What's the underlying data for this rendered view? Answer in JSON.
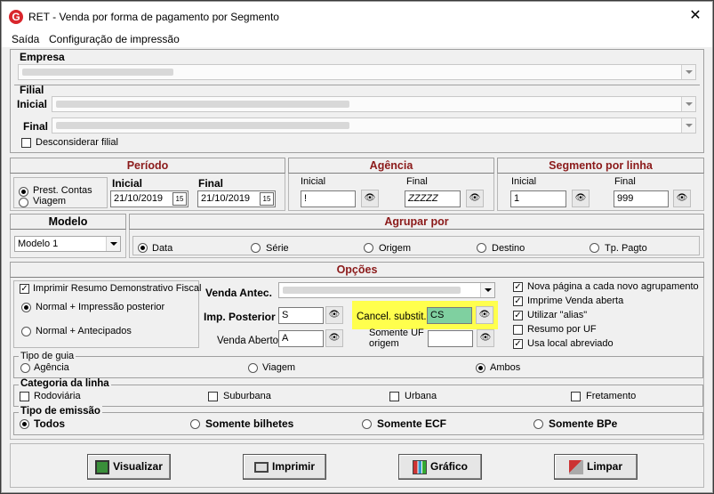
{
  "window": {
    "title": "RET - Venda por forma de pagamento por Segmento",
    "close": "✕",
    "app_icon": "G"
  },
  "menu": [
    "Saída",
    "Configuração de impressão"
  ],
  "empresa": {
    "label": "Empresa"
  },
  "filial": {
    "label": "Filial",
    "inicial": "Inicial",
    "final": "Final",
    "desconsiderar": "Desconsiderar filial"
  },
  "periodo": {
    "title": "Período",
    "prest": "Prest. Contas",
    "viagem": "Viagem",
    "inicial_label": "Inicial",
    "final_label": "Final",
    "inicial": "21/10/2019",
    "final": "21/10/2019",
    "cal": "15"
  },
  "agencia": {
    "title": "Agência",
    "inicial_label": "Inicial",
    "final_label": "Final",
    "inicial": "!",
    "final": "ZZZZZ"
  },
  "segmento": {
    "title": "Segmento por linha",
    "inicial_label": "Inicial",
    "final_label": "Final",
    "inicial": "1",
    "final": "999"
  },
  "modelo": {
    "title": "Modelo",
    "value": "Modelo 1"
  },
  "agrupar": {
    "title": "Agrupar por",
    "options": [
      "Data",
      "Série",
      "Origem",
      "Destino",
      "Tp. Pagto"
    ]
  },
  "opcoes": {
    "title": "Opções",
    "imprimir_resumo": "Imprimir Resumo Demonstrativo Fiscal",
    "normal_impressao": "Normal + Impressão posterior",
    "normal_antecipados": "Normal + Antecipados",
    "venda_antec": "Venda Antec.",
    "imp_posterior": "Imp. Posterior",
    "imp_posterior_value": "S",
    "venda_aberto": "Venda Aberto",
    "venda_aberto_value": "A",
    "cancel_subst": "Cancel. substit.",
    "cancel_subst_value": "CS",
    "somente_uf": "Somente UF",
    "origem": "origem",
    "checks": [
      "Nova página a cada novo agrupamento",
      "Imprime Venda aberta",
      "Utilizar \"alias\"",
      "Resumo por UF",
      "Usa local abreviado"
    ]
  },
  "tipo_guia": {
    "title": "Tipo de guia",
    "options": [
      "Agência",
      "Viagem",
      "Ambos"
    ]
  },
  "categoria": {
    "title": "Categoria da linha",
    "options": [
      "Rodoviária",
      "Suburbana",
      "Urbana",
      "Fretamento"
    ]
  },
  "emissao": {
    "title": "Tipo de emissão",
    "options": [
      "Todos",
      "Somente bilhetes",
      "Somente ECF",
      "Somente BPe"
    ]
  },
  "buttons": {
    "visualizar": "Visualizar",
    "imprimir": "Imprimir",
    "grafico": "Gráfico",
    "limpar": "Limpar"
  }
}
